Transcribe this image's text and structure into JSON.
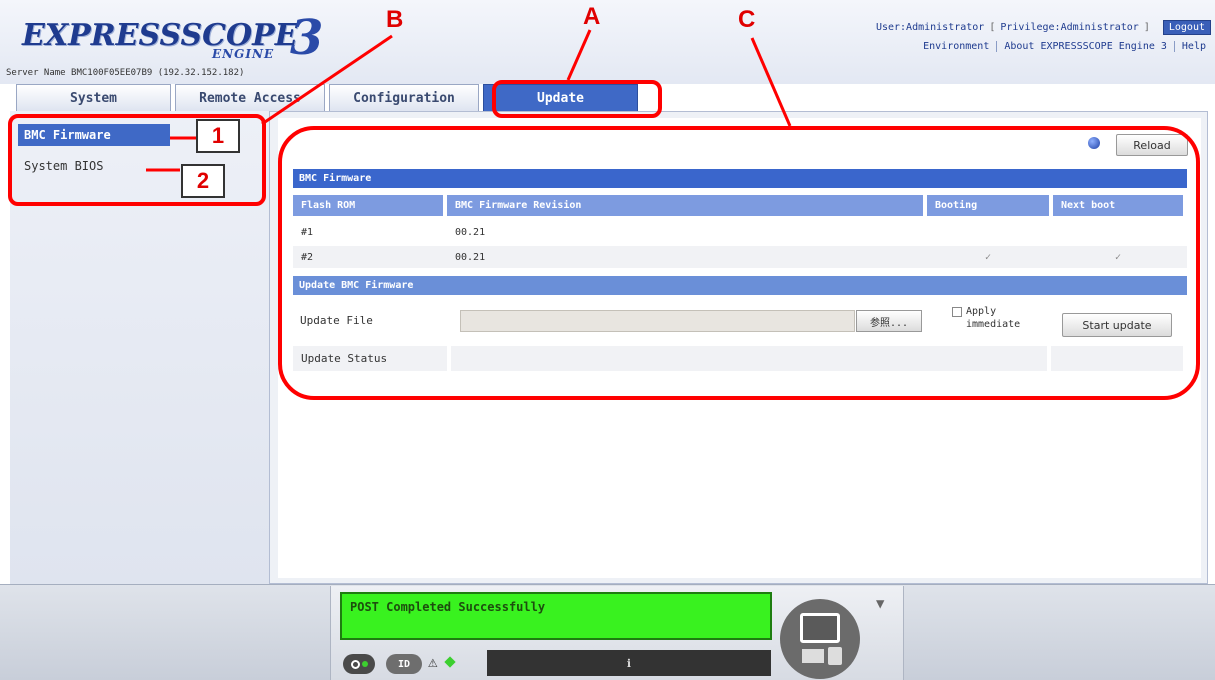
{
  "header": {
    "logo_word": "EXPRESSSCOPE",
    "logo_number": "3",
    "logo_sub": "ENGINE",
    "server_name": "Server Name BMC100F05EE07B9 (192.32.152.182)",
    "user": "User:Administrator",
    "privilege": "Privilege:Administrator",
    "logout": "Logout",
    "links": [
      "Environment",
      "About EXPRESSSCOPE Engine 3",
      "Help"
    ]
  },
  "tabs": [
    "System",
    "Remote Access",
    "Configuration",
    "Update"
  ],
  "active_tab": "Update",
  "sidebar": {
    "items": [
      "BMC Firmware",
      "System BIOS"
    ],
    "active": "BMC Firmware"
  },
  "content": {
    "reload_label": "Reload",
    "bmc_section": "BMC Firmware",
    "columns": [
      "Flash ROM",
      "BMC Firmware Revision",
      "Booting",
      "Next boot"
    ],
    "rows": [
      {
        "rom": "#1",
        "revision": "00.21",
        "booting": "",
        "next_boot": ""
      },
      {
        "rom": "#2",
        "revision": "00.21",
        "booting": "✓",
        "next_boot": "✓"
      }
    ],
    "update_section": "Update BMC Firmware",
    "update_file_label": "Update File",
    "browse_label": "参照...",
    "apply_label": "Apply immediate",
    "start_label": "Start update",
    "update_status_label": "Update Status"
  },
  "footer": {
    "lcd_text": "POST Completed Successfully",
    "id_label": "ID",
    "status_bar_text": "ℹ"
  },
  "annotations": {
    "letters": [
      "A",
      "B",
      "C"
    ],
    "numbers": [
      "1",
      "2"
    ]
  },
  "colors": {
    "accent": "#3f69c6",
    "lcd": "#39f21f",
    "annotation": "#ff0000"
  }
}
